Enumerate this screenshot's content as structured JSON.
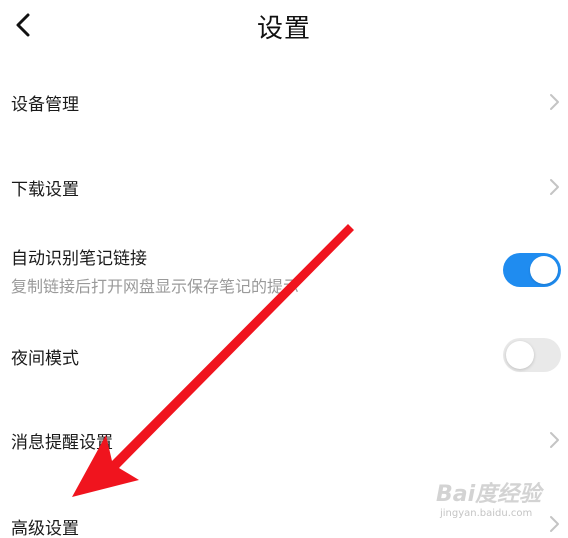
{
  "header": {
    "title": "设置",
    "back_icon": "chevron-left-icon"
  },
  "settings": {
    "device_management": {
      "label": "设备管理"
    },
    "download_settings": {
      "label": "下载设置"
    },
    "auto_detect_note_link": {
      "label": "自动识别笔记链接",
      "sublabel": "复制链接后打开网盘显示保存笔记的提示",
      "enabled": true
    },
    "night_mode": {
      "label": "夜间模式",
      "enabled": false
    },
    "notification_settings": {
      "label": "消息提醒设置"
    },
    "advanced_settings": {
      "label": "高级设置"
    }
  },
  "colors": {
    "toggle_on": "#1f8cf0",
    "toggle_off": "#e9e9e9",
    "annotation_arrow": "#f0141e"
  },
  "watermark": {
    "brand": "Bai度经验",
    "url": "jingyan.baidu.com"
  }
}
